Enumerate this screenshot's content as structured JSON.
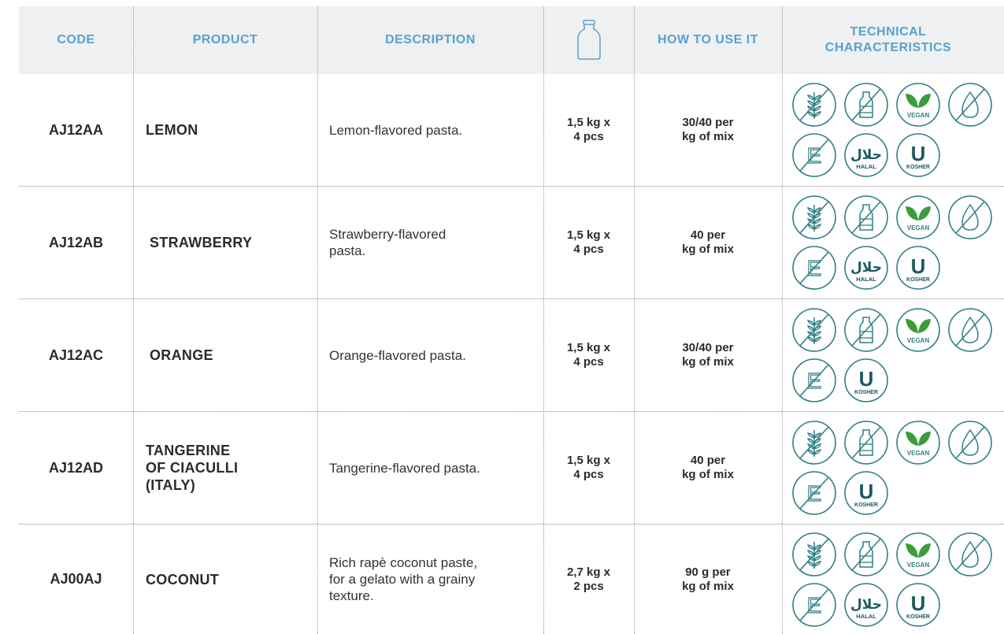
{
  "header": {
    "code": "CODE",
    "product": "PRODUCT",
    "description": "DESCRIPTION",
    "packaging_icon": "jar-icon",
    "how_to_use": "HOW TO USE IT",
    "technical": "TECHNICAL\nCHARACTERISTICS"
  },
  "colors": {
    "header_text": "#5b9fd0",
    "header_bg": "#eef0f1",
    "icon_teal": "#2f7f86",
    "vegan_green": "#3d9c3a"
  },
  "rows": [
    {
      "code": "AJ12AA",
      "product": "LEMON",
      "description": "Lemon-flavored pasta.",
      "packaging": "1,5 kg x\n4 pcs",
      "usage": "30/40 per\nkg of mix",
      "badges": [
        "gluten-free-icon",
        "lactose-free-icon",
        "vegan-icon",
        "fat-free-icon",
        "no-e-numbers-icon",
        "halal-icon",
        "kosher-icon"
      ]
    },
    {
      "code": "AJ12AB",
      "product": "STRAWBERRY",
      "description": "Strawberry-flavored\npasta.",
      "packaging": "1,5 kg x\n4 pcs",
      "usage": "40 per\nkg of mix",
      "badges": [
        "gluten-free-icon",
        "lactose-free-icon",
        "vegan-icon",
        "fat-free-icon",
        "no-e-numbers-icon",
        "halal-icon",
        "kosher-icon"
      ]
    },
    {
      "code": "AJ12AC",
      "product": "ORANGE",
      "description": "Orange-flavored pasta.",
      "packaging": "1,5 kg x\n4 pcs",
      "usage": "30/40 per\nkg of mix",
      "badges": [
        "gluten-free-icon",
        "lactose-free-icon",
        "vegan-icon",
        "fat-free-icon",
        "no-e-numbers-icon",
        "kosher-icon"
      ]
    },
    {
      "code": "AJ12AD",
      "product": "TANGERINE\nOF CIACULLI\n(ITALY)",
      "description": "Tangerine-flavored pasta.",
      "packaging": "1,5 kg x\n4 pcs",
      "usage": "40 per\nkg of mix",
      "badges": [
        "gluten-free-icon",
        "lactose-free-icon",
        "vegan-icon",
        "fat-free-icon",
        "no-e-numbers-icon",
        "kosher-icon"
      ]
    },
    {
      "code": "AJ00AJ",
      "product": "COCONUT",
      "description": "Rich rapè coconut paste,\nfor a gelato with a grainy\ntexture.",
      "packaging": "2,7 kg x\n2 pcs",
      "usage": "90 g per\nkg of mix",
      "badges": [
        "gluten-free-icon",
        "lactose-free-icon",
        "vegan-icon",
        "fat-free-icon",
        "no-e-numbers-icon",
        "halal-icon",
        "kosher-icon"
      ]
    }
  ],
  "badge_text": {
    "vegan": "VEGAN",
    "halal": "HALAL",
    "halal_script": "حلال",
    "kosher": "KOSHER",
    "kosher_letter": "U",
    "e_letter": "E"
  }
}
